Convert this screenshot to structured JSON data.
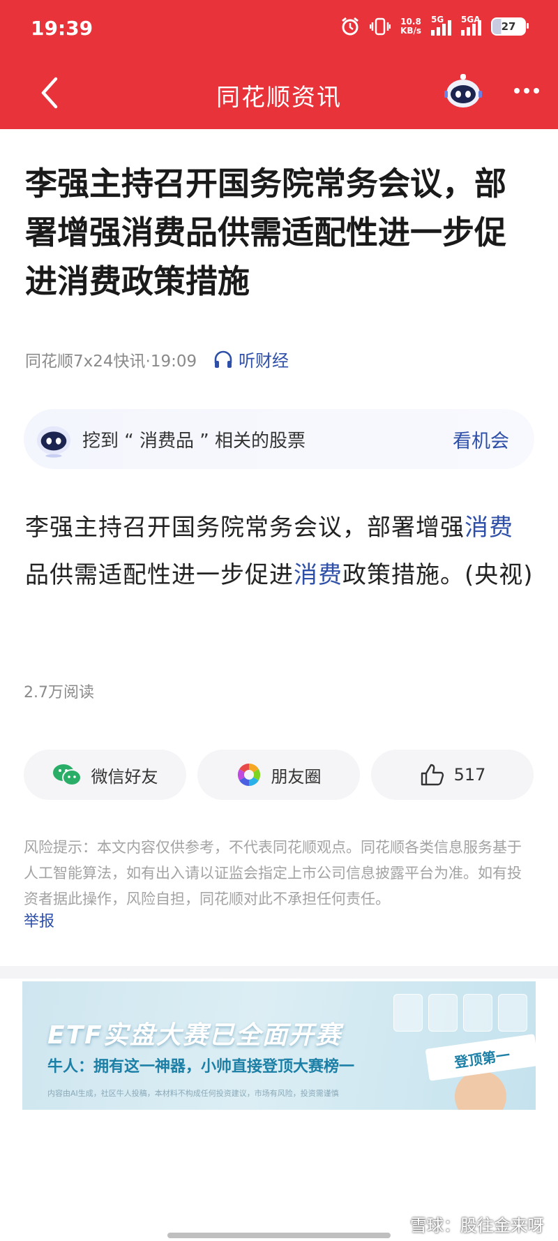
{
  "status_bar": {
    "time": "19:39",
    "speed_value": "10.8",
    "speed_unit": "KB/s",
    "network1": "5G",
    "network2": "5GA",
    "battery": "27"
  },
  "nav": {
    "title": "同花顺资讯"
  },
  "article": {
    "headline": "李强主持召开国务院常务会议，部署增强消费品供需适配性进一步促进消费政策措施",
    "source": "同花顺7x24快讯·19:09",
    "listen_label": "听财经",
    "body_part1": "李强主持召开国务院常务会议，部署增强",
    "body_keyword1": "消费",
    "body_part2": "品供需适配性进一步促进",
    "body_keyword2": "消费",
    "body_part3": "政策措施。(央视)",
    "read_count": "2.7万阅读"
  },
  "opportunity": {
    "text": "挖到 “ 消费品 ” 相关的股票",
    "link": "看机会"
  },
  "share": {
    "wechat_label": "微信好友",
    "moments_label": "朋友圈",
    "like_count": "517"
  },
  "disclaimer": {
    "text": "风险提示：本文内容仅供参考，不代表同花顺观点。同花顺各类信息服务基于人工智能算法，如有出入请以证监会指定上市公司信息披露平台为准。如有投资者据此操作，风险自担，同花顺对此不承担任何责任。",
    "report_label": "举报"
  },
  "banner": {
    "title": "ETF实盘大赛已全面开赛",
    "subtitle": "牛人：拥有这一神器，小帅直接登顶大赛榜一",
    "small_print": "内容由AI生成，社区牛人投稿，本材料不构成任何投资建议，市场有风险，投资需谨慎",
    "towel_text": "登顶第一"
  },
  "watermark": "雪球：股往金来呀",
  "colors": {
    "brand_red": "#e8333b",
    "link_blue": "#2e4fa8"
  }
}
